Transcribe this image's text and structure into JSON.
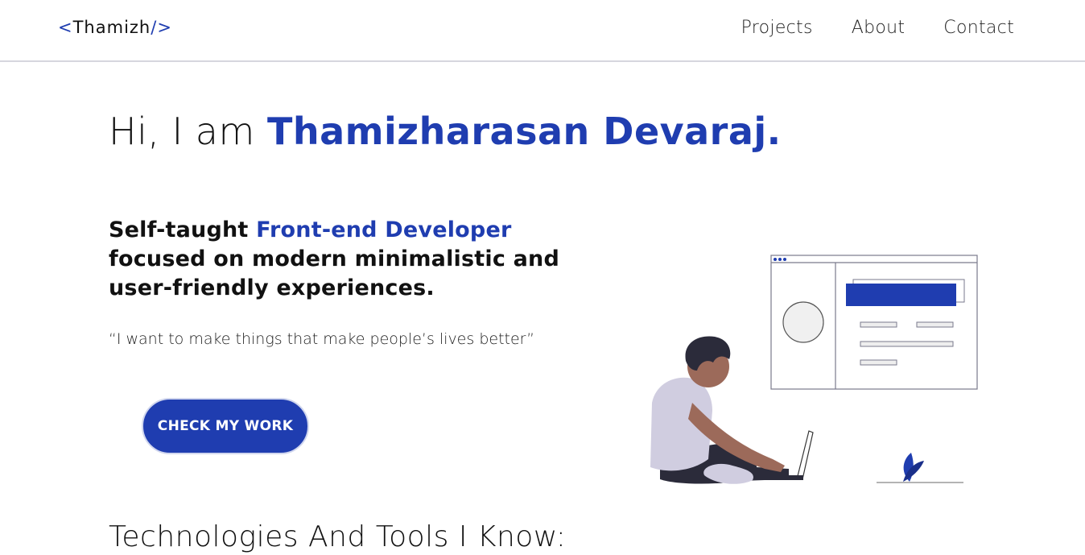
{
  "nav": {
    "logo_open": "<",
    "logo_text": "Thamizh",
    "logo_close": "/>",
    "links": [
      {
        "label": "Projects"
      },
      {
        "label": "About"
      },
      {
        "label": "Contact"
      }
    ]
  },
  "hero": {
    "greeting": "Hi, I am ",
    "name": "Thamizharasan Devaraj.",
    "tagline_prefix": "Self-taught ",
    "tagline_role": "Front-end Developer",
    "tagline_rest": "focused on modern minimalistic and user-friendly experiences.",
    "quote": "“I want to make things that make people’s lives better”",
    "cta_label": "CHECK MY WORK"
  },
  "technologies": {
    "title": "Technologies And Tools I Know:"
  },
  "colors": {
    "accent": "#1f3db0",
    "text": "#111111",
    "divider": "#d6d6de"
  }
}
